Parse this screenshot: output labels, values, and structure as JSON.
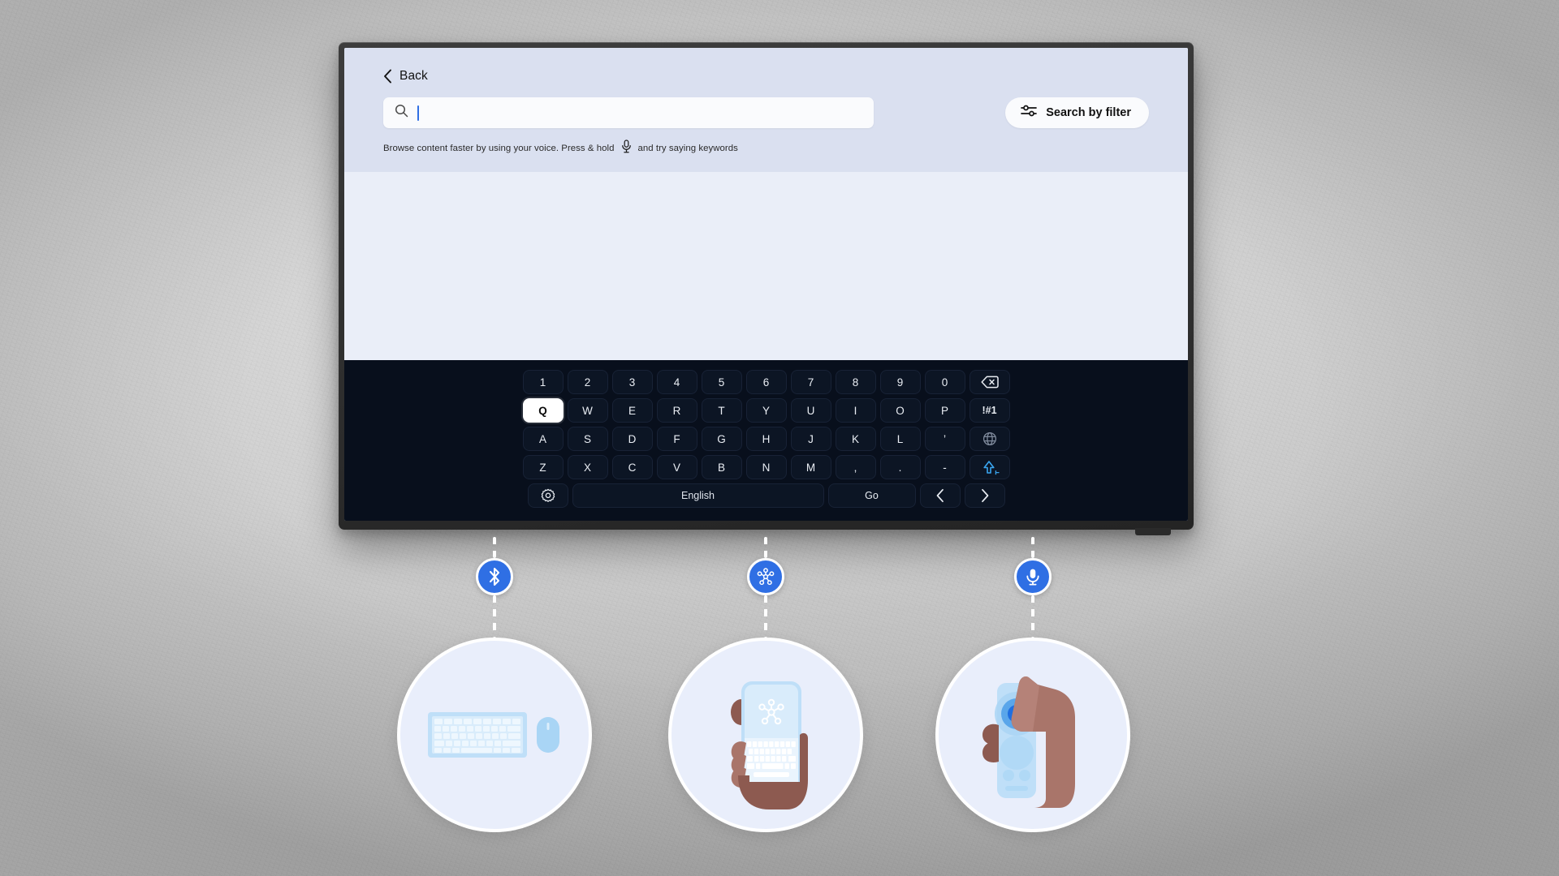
{
  "screen": {
    "back_label": "Back",
    "back_icon": "chevron-left-icon",
    "search": {
      "icon": "search-icon",
      "value": "",
      "placeholder": ""
    },
    "filter_button": {
      "label": "Search by filter",
      "icon": "sliders-filter-icon"
    },
    "hint": {
      "before": "Browse content faster by using your voice. Press & hold",
      "icon": "microphone-icon",
      "after": "and try saying keywords"
    }
  },
  "keyboard": {
    "language": "English",
    "rows": [
      {
        "name": "number-row",
        "keys": [
          {
            "label": "1",
            "name": "key-1"
          },
          {
            "label": "2",
            "name": "key-2"
          },
          {
            "label": "3",
            "name": "key-3"
          },
          {
            "label": "4",
            "name": "key-4"
          },
          {
            "label": "5",
            "name": "key-5"
          },
          {
            "label": "6",
            "name": "key-6"
          },
          {
            "label": "7",
            "name": "key-7"
          },
          {
            "label": "8",
            "name": "key-8"
          },
          {
            "label": "9",
            "name": "key-9"
          },
          {
            "label": "0",
            "name": "key-0"
          },
          {
            "label": "",
            "name": "key-backspace",
            "icon": "backspace-icon"
          }
        ]
      },
      {
        "name": "qwerty-row",
        "keys": [
          {
            "label": "Q",
            "name": "key-q",
            "selected": true
          },
          {
            "label": "W",
            "name": "key-w"
          },
          {
            "label": "E",
            "name": "key-e"
          },
          {
            "label": "R",
            "name": "key-r"
          },
          {
            "label": "T",
            "name": "key-t"
          },
          {
            "label": "Y",
            "name": "key-y"
          },
          {
            "label": "U",
            "name": "key-u"
          },
          {
            "label": "I",
            "name": "key-i"
          },
          {
            "label": "O",
            "name": "key-o"
          },
          {
            "label": "P",
            "name": "key-p"
          },
          {
            "label": "!#1",
            "name": "key-symbols"
          }
        ]
      },
      {
        "name": "home-row",
        "keys": [
          {
            "label": "A",
            "name": "key-a"
          },
          {
            "label": "S",
            "name": "key-s"
          },
          {
            "label": "D",
            "name": "key-d"
          },
          {
            "label": "F",
            "name": "key-f"
          },
          {
            "label": "G",
            "name": "key-g"
          },
          {
            "label": "H",
            "name": "key-h"
          },
          {
            "label": "J",
            "name": "key-j"
          },
          {
            "label": "K",
            "name": "key-k"
          },
          {
            "label": "L",
            "name": "key-l"
          },
          {
            "label": "’",
            "name": "key-apostrophe"
          },
          {
            "label": "",
            "name": "key-language-globe",
            "icon": "globe-icon"
          }
        ]
      },
      {
        "name": "bottom-letter-row",
        "keys": [
          {
            "label": "Z",
            "name": "key-z"
          },
          {
            "label": "X",
            "name": "key-x"
          },
          {
            "label": "C",
            "name": "key-c"
          },
          {
            "label": "V",
            "name": "key-v"
          },
          {
            "label": "B",
            "name": "key-b"
          },
          {
            "label": "N",
            "name": "key-n"
          },
          {
            "label": "M",
            "name": "key-m"
          },
          {
            "label": ",",
            "name": "key-comma"
          },
          {
            "label": ".",
            "name": "key-period"
          },
          {
            "label": "-",
            "name": "key-hyphen"
          },
          {
            "label": "",
            "name": "key-shift",
            "icon": "shift-icon"
          }
        ]
      },
      {
        "name": "function-row",
        "keys": [
          {
            "label": "",
            "name": "key-settings",
            "icon": "gear-icon"
          },
          {
            "label": "English",
            "name": "key-spacebar"
          },
          {
            "label": "Go",
            "name": "key-go"
          },
          {
            "label": "",
            "name": "key-cursor-left",
            "icon": "chevron-left-icon"
          },
          {
            "label": "",
            "name": "key-cursor-right",
            "icon": "chevron-right-icon"
          }
        ]
      }
    ]
  },
  "callouts": [
    {
      "name": "bluetooth-callout",
      "badge_icon": "bluetooth-icon",
      "illustration": "keyboard-and-mouse-illustration"
    },
    {
      "name": "smartthings-callout",
      "badge_icon": "smartthings-node-icon",
      "illustration": "hand-holding-phone-keyboard-illustration"
    },
    {
      "name": "voice-callout",
      "badge_icon": "microphone-icon",
      "illustration": "hand-holding-remote-illustration"
    }
  ],
  "colors": {
    "accent_blue": "#2f6fe4",
    "header_band": "#dae0f0",
    "content_bg": "#eaeef8",
    "keyboard_bg": "#080f1c",
    "illus_bg": "#e9eefb",
    "illus_blue": "#b9dcf7",
    "skin": "#a9756a"
  }
}
